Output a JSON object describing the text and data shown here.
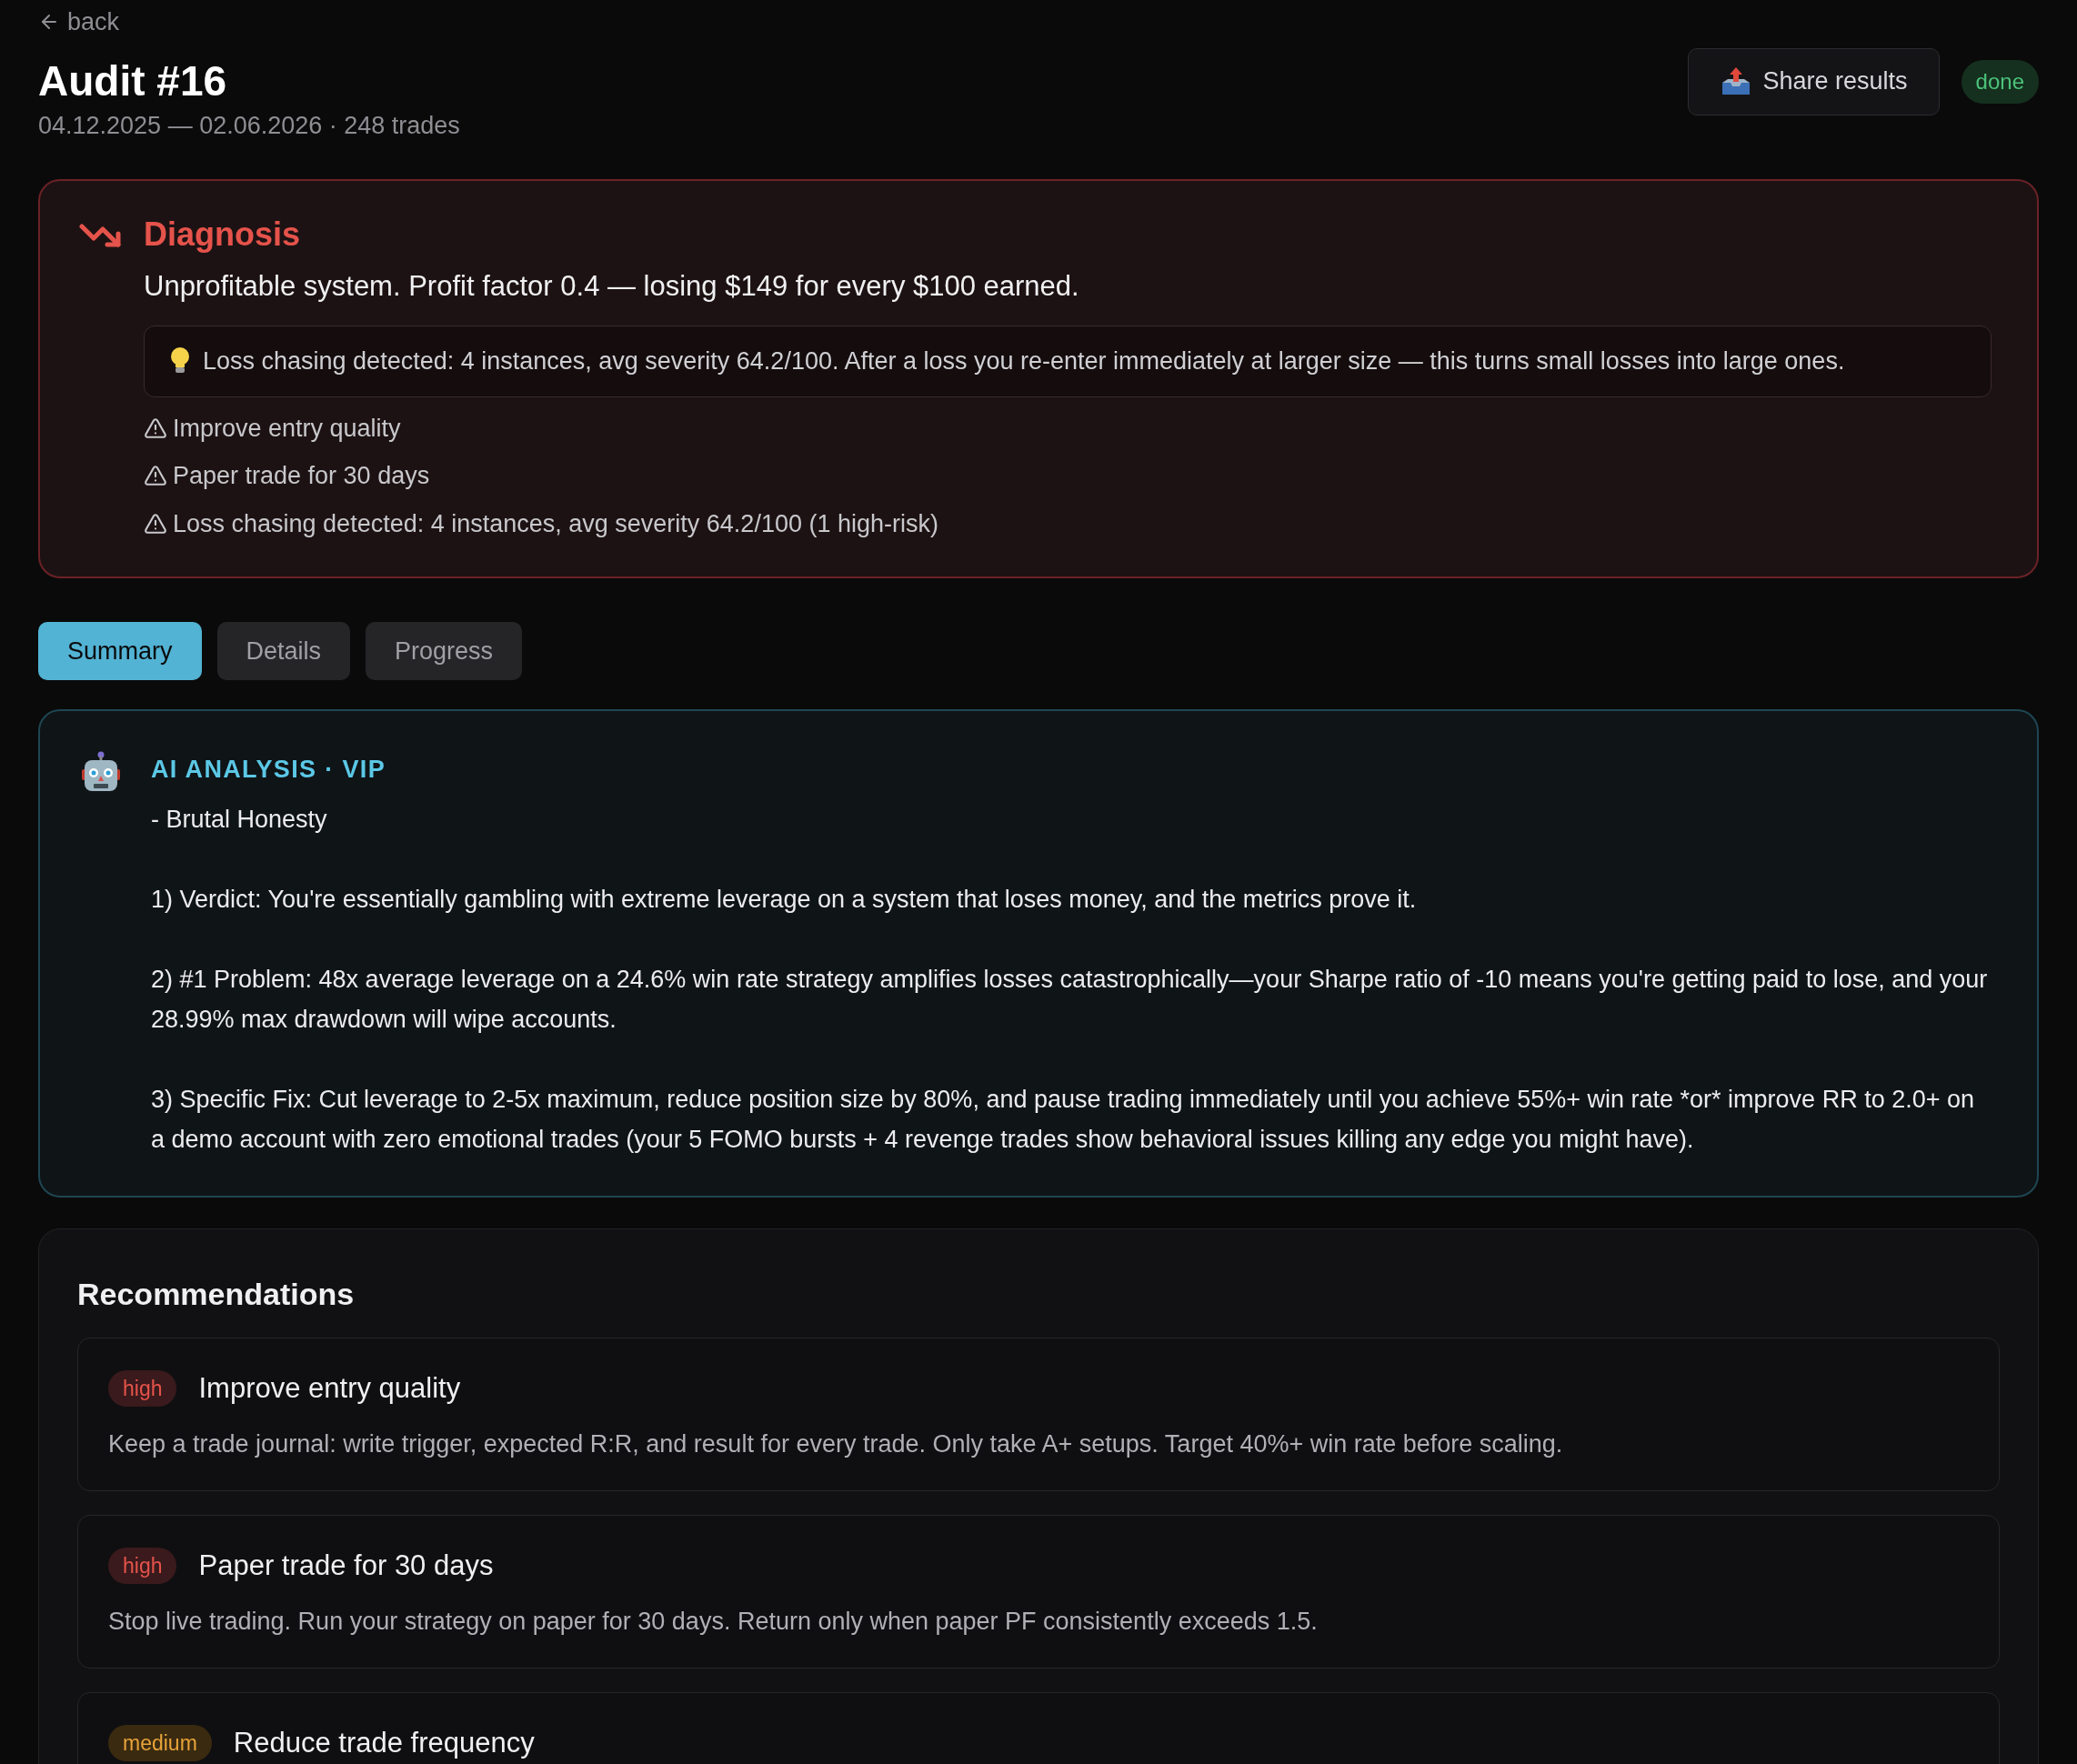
{
  "back_link": "back",
  "header": {
    "title": "Audit #16",
    "subtitle": "04.12.2025 — 02.06.2026 · 248 trades",
    "share_button": "Share results",
    "status": "done"
  },
  "diagnosis": {
    "title": "Diagnosis",
    "summary": "Unprofitable system. Profit factor 0.4 — losing $149 for every $100 earned.",
    "insight": "Loss chasing detected: 4 instances, avg severity 64.2/100. After a loss you re-enter immediately at larger size — this turns small losses into large ones.",
    "warnings": [
      "Improve entry quality",
      "Paper trade for 30 days",
      "Loss chasing detected: 4 instances, avg severity 64.2/100 (1 high-risk)"
    ]
  },
  "tabs": [
    {
      "label": "Summary",
      "selected": true
    },
    {
      "label": "Details",
      "selected": false
    },
    {
      "label": "Progress",
      "selected": false
    }
  ],
  "ai_analysis": {
    "title": "AI ANALYSIS · VIP",
    "paragraphs": [
      "- Brutal Honesty",
      "1) Verdict: You're essentially gambling with extreme leverage on a system that loses money, and the metrics prove it.",
      "2) #1 Problem: 48x average leverage on a 24.6% win rate strategy amplifies losses catastrophically—your Sharpe ratio of -10 means you're getting paid to lose, and your 28.99% max drawdown will wipe accounts.",
      "3) Specific Fix: Cut leverage to 2-5x maximum, reduce position size by 80%, and pause trading immediately until you achieve 55%+ win rate *or* improve RR to 2.0+ on a demo account with zero emotional trades (your 5 FOMO bursts + 4 revenge trades show behavioral issues killing any edge you might have)."
    ]
  },
  "recommendations": {
    "title": "Recommendations",
    "items": [
      {
        "kind": "high",
        "priority": "high",
        "title": "Improve entry quality",
        "description": "Keep a trade journal: write trigger, expected R:R, and result for every trade. Only take A+ setups. Target 40%+ win rate before scaling."
      },
      {
        "kind": "high",
        "priority": "high",
        "title": "Paper trade for 30 days",
        "description": "Stop live trading. Run your strategy on paper for 30 days. Return only when paper PF consistently exceeds 1.5."
      },
      {
        "kind": "medium",
        "priority": "medium",
        "title": "Reduce trade frequency"
      }
    ]
  }
}
